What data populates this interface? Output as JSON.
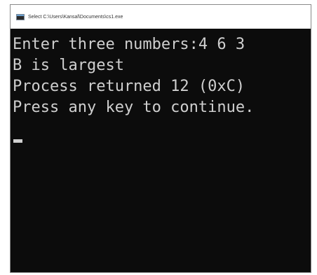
{
  "window": {
    "title": "Select C:\\Users\\Kansal\\Documents\\cs1.exe"
  },
  "console": {
    "lines": [
      "Enter three numbers:4 6 3",
      "B is largest",
      "Process returned 12 (0xC)",
      "Press any key to continue."
    ]
  },
  "colors": {
    "console_background": "#0c0c0c",
    "console_text": "#cfcfcf",
    "titlebar_background": "#ffffff"
  }
}
